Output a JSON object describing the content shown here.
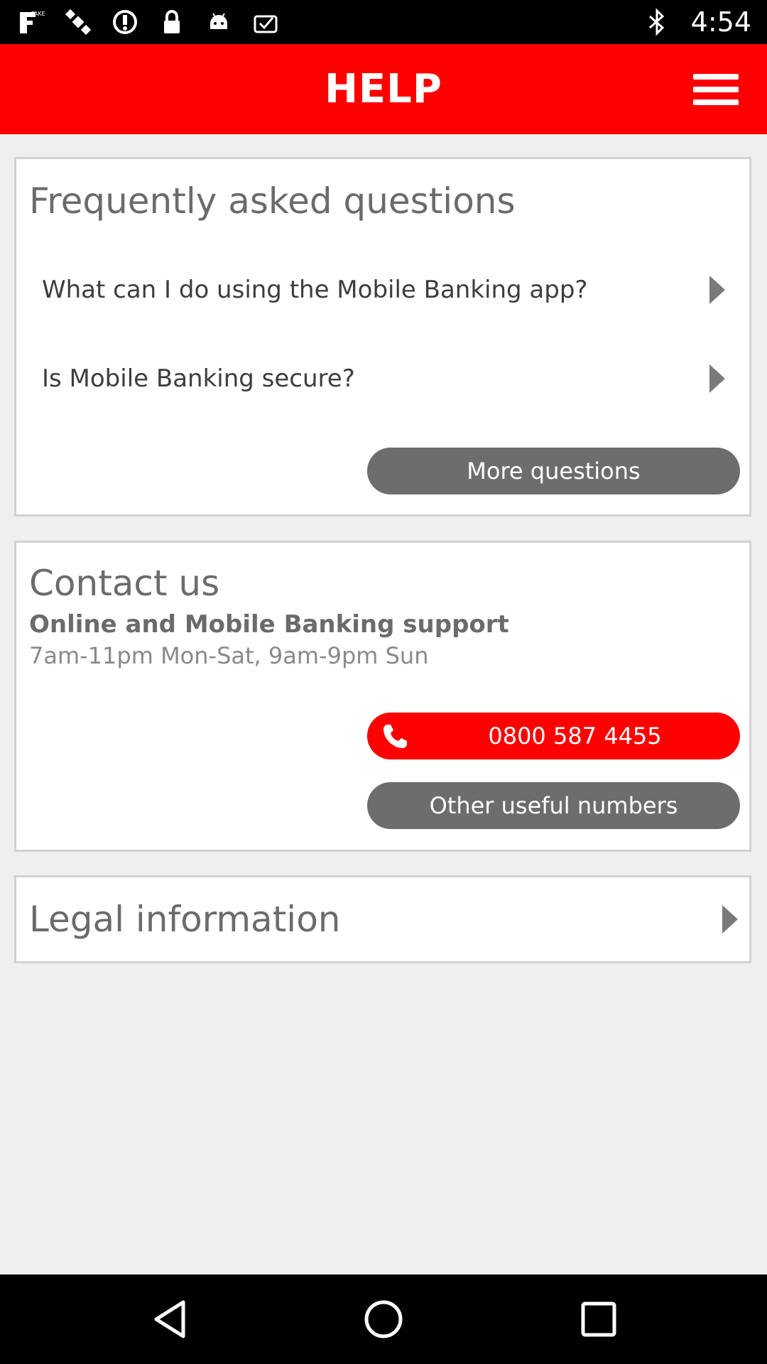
{
  "status_bar": {
    "time": "4:54",
    "left_icons": [
      "fake-gps-icon",
      "satellite-icon",
      "sync-icon",
      "lock-icon",
      "android-icon",
      "clipboard-check-icon"
    ],
    "right_icons": [
      "bluetooth-icon"
    ]
  },
  "header": {
    "title": "HELP",
    "menu_icon": "hamburger-menu-icon",
    "color": "#ff0000"
  },
  "faq": {
    "title": "Frequently asked questions",
    "items": [
      {
        "label": "What can I do using the Mobile Banking app?"
      },
      {
        "label": "Is Mobile Banking secure?"
      }
    ],
    "more_button": "More questions"
  },
  "contact": {
    "title": "Contact us",
    "subtitle": "Online and Mobile Banking support",
    "hours": "7am-11pm Mon-Sat, 9am-9pm Sun",
    "phone_number": "0800 587 4455",
    "other_numbers_button": "Other useful numbers"
  },
  "legal": {
    "title": "Legal information"
  },
  "nav_bar": {
    "icons": [
      "back-icon",
      "home-icon",
      "recents-icon"
    ]
  }
}
